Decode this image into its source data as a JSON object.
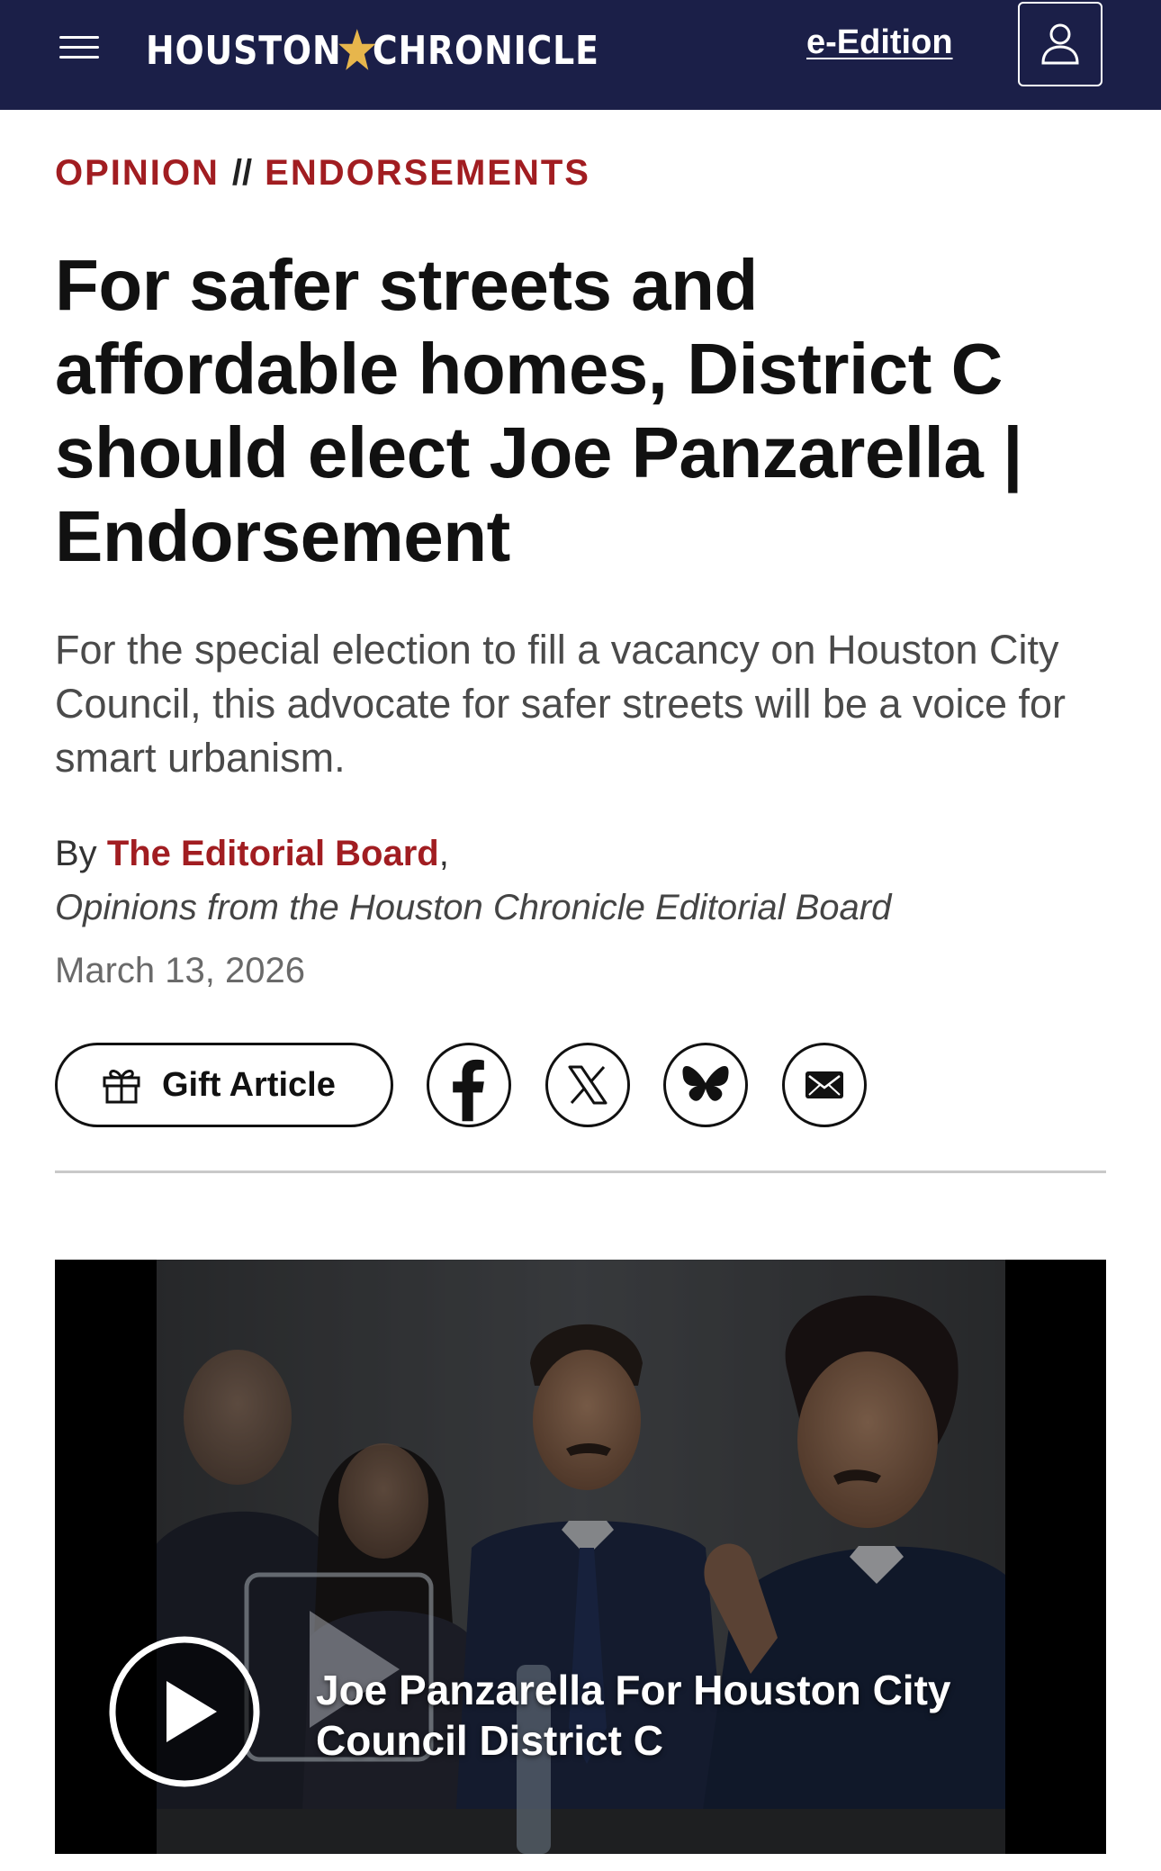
{
  "header": {
    "logo_left": "HOUSTON",
    "logo_right": "CHRONICLE",
    "eedition_label": "e-Edition"
  },
  "article": {
    "kicker_section": "OPINION",
    "kicker_separator": "//",
    "kicker_subsection": "ENDORSEMENTS",
    "headline": "For safer streets and affordable homes, District C should elect Joe Panzarella | Endorsement",
    "dek": "For the special election to fill a vacancy on Houston City Council, this advocate for safer streets will be a voice for smart urbanism.",
    "byline_prefix": "By",
    "author": "The Editorial Board",
    "byline_comma": ",",
    "affiliation": "Opinions from the Houston Chronicle Editorial Board",
    "date": "March 13, 2026"
  },
  "actions": {
    "gift_label": "Gift Article",
    "share_icons": [
      "facebook-icon",
      "x-icon",
      "bluesky-icon",
      "email-icon"
    ]
  },
  "video": {
    "title": "Joe Panzarella For Houston City Council District C"
  },
  "colors": {
    "nav_bg": "#1b1f48",
    "kicker": "#a11d21",
    "author": "#a11d21",
    "logo_star": "#e7b64c"
  }
}
